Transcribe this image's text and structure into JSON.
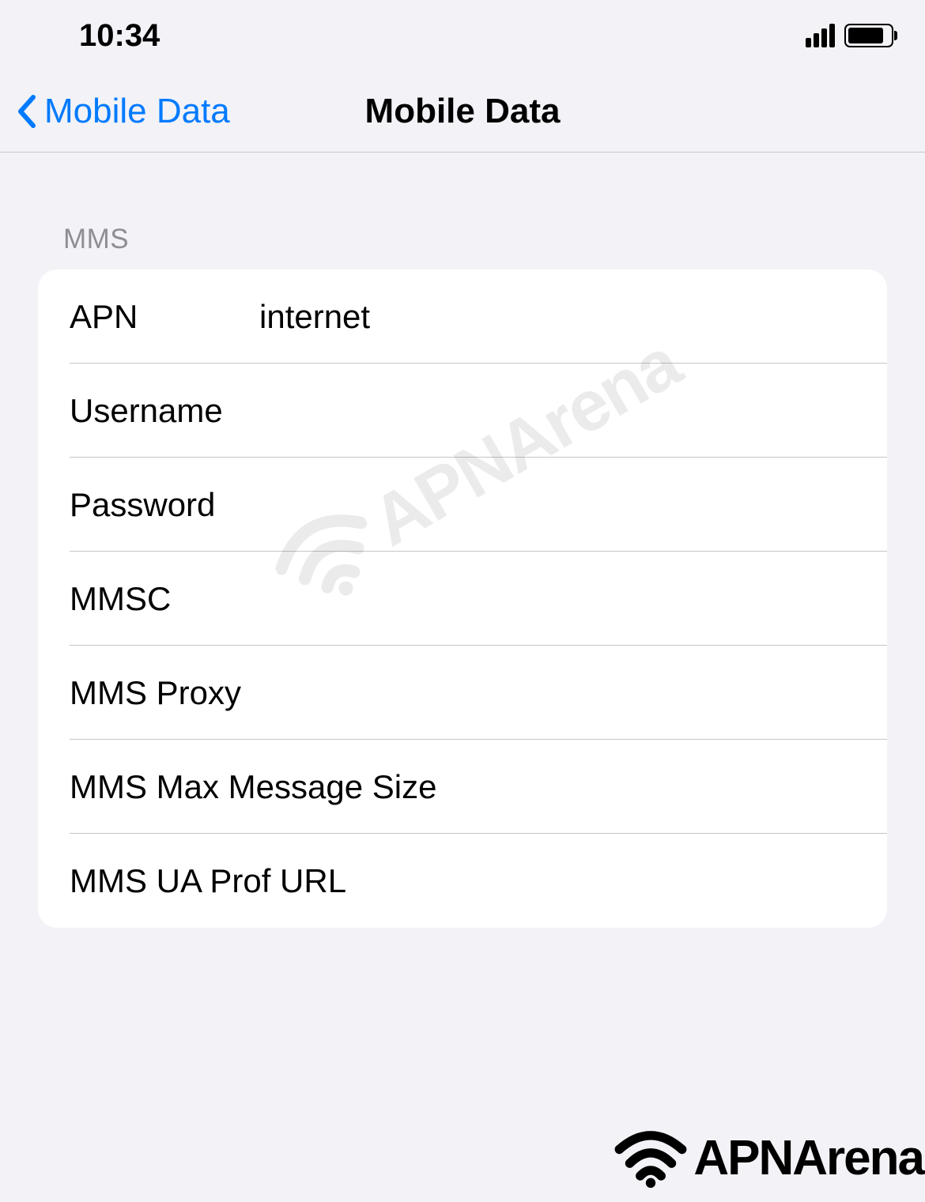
{
  "status": {
    "time": "10:34"
  },
  "nav": {
    "back_label": "Mobile Data",
    "title": "Mobile Data"
  },
  "section": {
    "header": "MMS"
  },
  "fields": {
    "apn": {
      "label": "APN",
      "value": "internet"
    },
    "username": {
      "label": "Username",
      "value": ""
    },
    "password": {
      "label": "Password",
      "value": ""
    },
    "mmsc": {
      "label": "MMSC",
      "value": ""
    },
    "mms_proxy": {
      "label": "MMS Proxy",
      "value": ""
    },
    "mms_max_size": {
      "label": "MMS Max Message Size",
      "value": ""
    },
    "mms_ua_prof": {
      "label": "MMS UA Prof URL",
      "value": ""
    }
  },
  "watermark": {
    "text": "APNArena"
  },
  "footer": {
    "text": "APNArena"
  }
}
